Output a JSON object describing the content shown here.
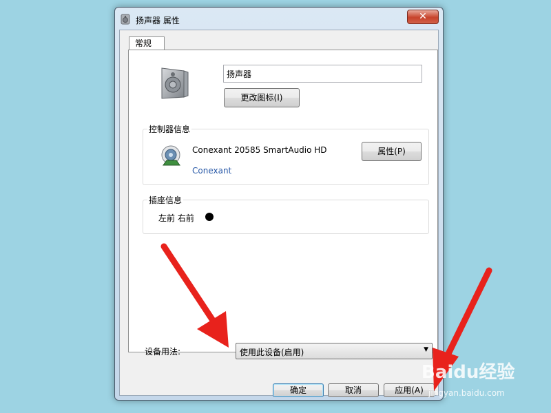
{
  "window": {
    "title": "扬声器 属性",
    "close_label": "✕"
  },
  "tabs": [
    {
      "label": "常规"
    }
  ],
  "general": {
    "name_value": "扬声器",
    "change_icon_label": "更改图标(I)",
    "controller": {
      "legend": "控制器信息",
      "name": "Conexant 20585 SmartAudio HD",
      "vendor_link": "Conexant",
      "properties_label": "属性(P)"
    },
    "jack": {
      "legend": "插座信息",
      "text": "左前 右前"
    },
    "usage": {
      "label": "设备用法:",
      "selected": "使用此设备(启用)"
    }
  },
  "buttons": {
    "ok": "确定",
    "cancel": "取消",
    "apply": "应用(A)"
  },
  "watermark": {
    "main": "Baidu经验",
    "sub": "jingyan.baidu.com"
  },
  "colors": {
    "background": "#9dd3e3",
    "annotation_arrow": "#e8221c",
    "link": "#2a5aa8"
  }
}
